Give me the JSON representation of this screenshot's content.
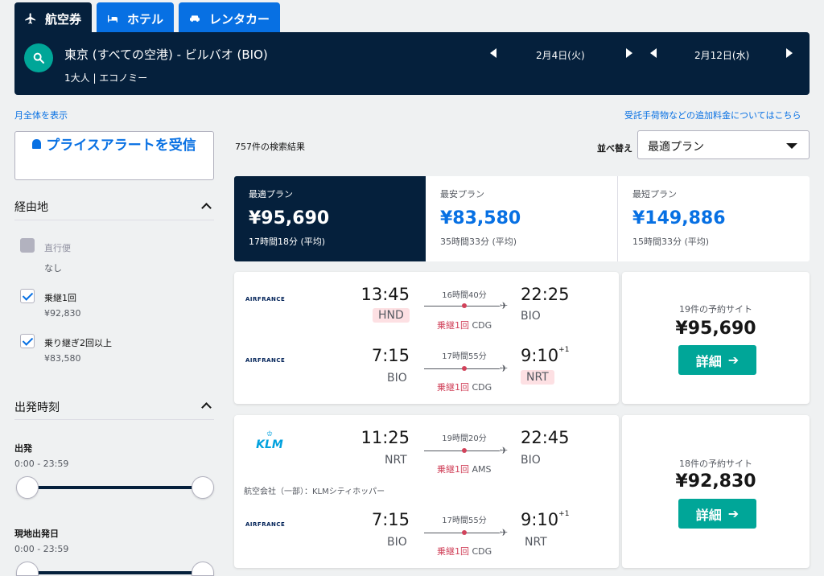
{
  "tabs": [
    {
      "label": "航空券",
      "icon": "plane-icon",
      "active": true
    },
    {
      "label": "ホテル",
      "icon": "bed-icon",
      "active": false
    },
    {
      "label": "レンタカー",
      "icon": "car-icon",
      "active": false
    }
  ],
  "search": {
    "route": "東京 (すべての空港) - ビルバオ (BIO)",
    "passengers": "1大人 | エコノミー",
    "depart_date": "2月4日(火)",
    "return_date": "2月12日(水)"
  },
  "links": {
    "month_view": "月全体を表示",
    "extra_fees": "受託手荷物などの追加料金についてはこちら"
  },
  "price_alert": {
    "label": "プライスアラートを受信"
  },
  "filters": {
    "stops": {
      "title": "経由地",
      "options": [
        {
          "label": "直行便",
          "sub": "なし",
          "checked": false,
          "disabled": true
        },
        {
          "label": "乗継1回",
          "sub": "¥92,830",
          "checked": true,
          "disabled": false
        },
        {
          "label": "乗り継ぎ2回以上",
          "sub": "¥83,580",
          "checked": true,
          "disabled": false
        }
      ]
    },
    "times": {
      "title": "出発時刻",
      "depart_label": "出発",
      "depart_range": "0:00 - 23:59",
      "local_label": "現地出発日",
      "local_range": "0:00 - 23:59"
    }
  },
  "results": {
    "count": "757件の検索結果"
  },
  "sort": {
    "label": "並べ替え",
    "value": "最適プラン"
  },
  "summary": [
    {
      "label": "最適プラン",
      "price": "¥95,690",
      "duration": "17時間18分 (平均)",
      "active": true
    },
    {
      "label": "最安プラン",
      "price": "¥83,580",
      "duration": "35時間33分 (平均)",
      "active": false
    },
    {
      "label": "最短プラン",
      "price": "¥149,886",
      "duration": "15時間33分 (平均)",
      "active": false
    }
  ],
  "cards": [
    {
      "legs": [
        {
          "airline": "AIRFRANCE",
          "dep_time": "13:45",
          "dep_apt": "HND",
          "arr_time": "22:25",
          "arr_apt": "BIO",
          "duration": "16時間40分",
          "stops": "乗継1回",
          "via": "CDG",
          "plus": ""
        },
        {
          "airline": "AIRFRANCE",
          "dep_time": "7:15",
          "dep_apt": "BIO",
          "arr_time": "9:10",
          "arr_apt": "NRT",
          "duration": "17時間55分",
          "stops": "乗継1回",
          "via": "CDG",
          "plus": "+1"
        }
      ],
      "sites": "19件の予約サイト",
      "price": "¥95,690",
      "button": "詳細"
    },
    {
      "legs": [
        {
          "airline": "KLM",
          "dep_time": "11:25",
          "dep_apt": "NRT",
          "arr_time": "22:45",
          "arr_apt": "BIO",
          "duration": "19時間20分",
          "stops": "乗継1回",
          "via": "AMS",
          "plus": ""
        },
        {
          "airline": "AIRFRANCE",
          "dep_time": "7:15",
          "dep_apt": "BIO",
          "arr_time": "9:10",
          "arr_apt": "NRT",
          "duration": "17時間55分",
          "stops": "乗継1回",
          "via": "CDG",
          "plus": "+1"
        }
      ],
      "operated_by": "航空会社（一部）：KLMシティホッパー",
      "sites": "18件の予約サイト",
      "price": "¥92,830",
      "button": "詳細"
    }
  ],
  "colors": {
    "navy": "#05203c",
    "blue": "#0770e3",
    "teal": "#00a698",
    "red": "#d1435b"
  }
}
